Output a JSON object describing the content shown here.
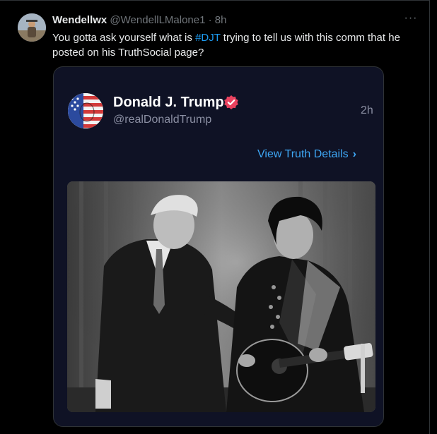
{
  "tweet": {
    "author_name": "Wendellwx",
    "author_handle": "@WendellLMalone1",
    "separator": " · ",
    "time": "8h",
    "more_label": "···",
    "text_before": "You gotta ask yourself what is ",
    "hashtag": "#DJT",
    "text_after": " trying to tell us with this comm that he posted on his TruthSocial page?"
  },
  "embed": {
    "name": "Donald J. Trump",
    "handle": "@realDonaldTrump",
    "time": "2h",
    "details_label": "View Truth Details",
    "details_chevron": "›"
  },
  "colors": {
    "background": "#000000",
    "card": "#0f1225",
    "link": "#1d9bf0",
    "details_link": "#3ea7f5",
    "verified": "#e9425f"
  },
  "icons": {
    "more": "more-icon",
    "verified": "verified-badge-icon",
    "chevron": "chevron-right-icon"
  }
}
